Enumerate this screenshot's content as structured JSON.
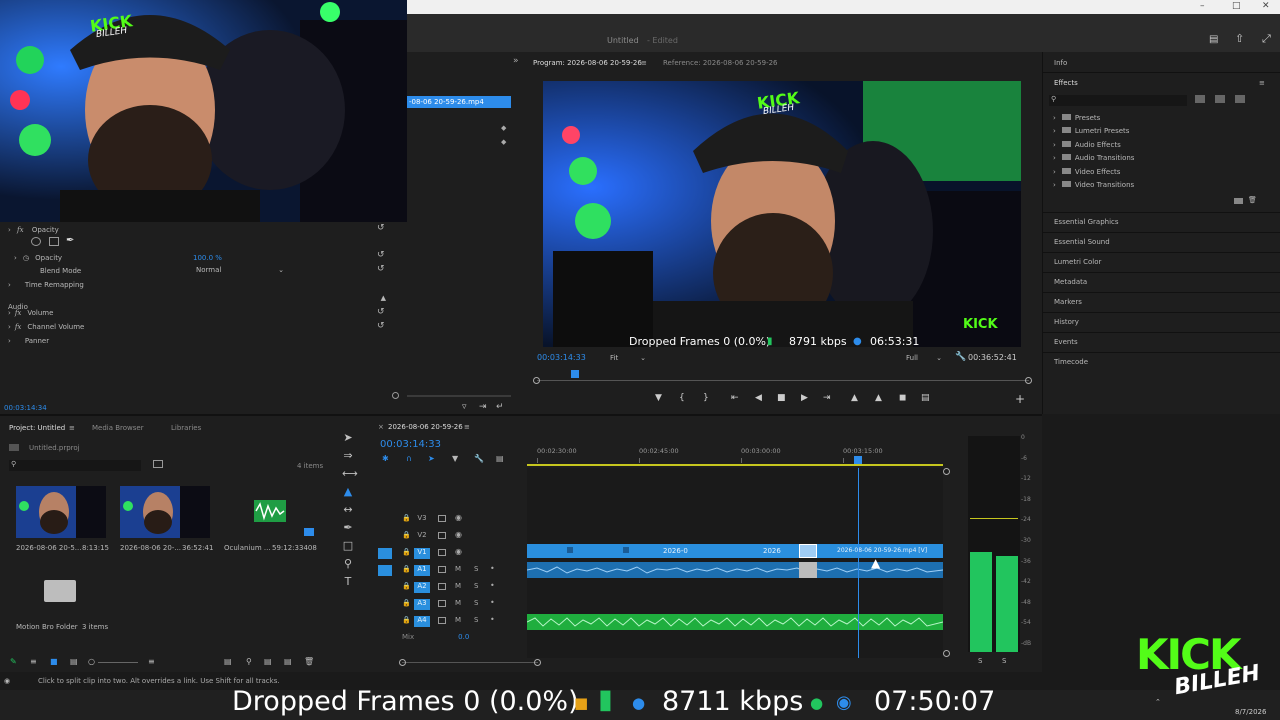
{
  "window": {
    "title": "Untitled",
    "edited": "- Edited"
  },
  "effect_controls": {
    "opacity_section": "Opacity",
    "opacity_label": "Opacity",
    "opacity_value": "100.0 %",
    "blend_label": "Blend Mode",
    "blend_value": "Normal",
    "time_remap": "Time Remapping",
    "audio_header": "Audio",
    "volume": "Volume",
    "channel_volume": "Channel Volume",
    "panner": "Panner",
    "timecode": "00:03:14:34"
  },
  "source_strip": {
    "clip_name": "-08-06 20-59-26.mp4",
    "header_partial": "-08-06 20-59-26"
  },
  "program": {
    "tab_program": "Program: 2026-08-06 20-59-26",
    "tab_reference": "Reference: 2026-08-06 20-59-26",
    "timecode_left": "00:03:14:33",
    "fit": "Fit",
    "full": "Full",
    "duration": "00:36:52:41"
  },
  "stats_overlay": {
    "dropped": "Dropped Frames 0 (0.0%)",
    "bitrate": "8791 kbps",
    "time": "06:53:31"
  },
  "bottom_stats": {
    "dropped": "Dropped Frames 0 (0.0%)",
    "bitrate": "8711 kbps",
    "time": "07:50:07"
  },
  "right_panel": {
    "info": "Info",
    "effects": "Effects",
    "tree": [
      "Presets",
      "Lumetri Presets",
      "Audio Effects",
      "Audio Transitions",
      "Video Effects",
      "Video Transitions"
    ],
    "sections": [
      "Essential Graphics",
      "Essential Sound",
      "Lumetri Color",
      "Metadata",
      "Markers",
      "History",
      "Events",
      "Timecode"
    ]
  },
  "project": {
    "tab_project": "Project: Untitled",
    "tab_media": "Media Browser",
    "tab_libraries": "Libraries",
    "file": "Untitled.prproj",
    "count": "4 items",
    "items": [
      {
        "name": "2026-08-06 20-5...",
        "dur": "8:13:15"
      },
      {
        "name": "2026-08-06 20-...",
        "dur": "36:52:41"
      },
      {
        "name": "Oculanium ...",
        "dur": "59:12:33408"
      }
    ],
    "folder_name": "Motion Bro Folder",
    "folder_count": "3 items"
  },
  "timeline": {
    "sequence": "2026-08-06 20-59-26",
    "timecode": "00:03:14:33",
    "ruler": [
      "00:02:30:00",
      "00:02:45:00",
      "00:03:00:00",
      "00:03:15:00"
    ],
    "video_tracks": [
      "V3",
      "V2",
      "V1"
    ],
    "audio_tracks": [
      "A1",
      "A2",
      "A3",
      "A4"
    ],
    "mix_label": "Mix",
    "mix_value": "0.0",
    "clip_labels": [
      "2026-0",
      "2026",
      "2026-08-06 20-59-26.mp4 [V]"
    ],
    "track_m": "M",
    "track_s": "S"
  },
  "meter": {
    "scale": [
      "0",
      "-6",
      "-12",
      "-18",
      "-24",
      "-30",
      "-36",
      "-42",
      "-48",
      "-54",
      "-dB"
    ],
    "ss": [
      "S",
      "S"
    ]
  },
  "status": {
    "hint": "Click to split clip into two. Alt overrides a link. Use Shift for all tracks."
  },
  "taskbar": {
    "date": "8/7/2026",
    "logo_text": "KICK",
    "logo_sub": "BILLEH"
  },
  "webcam_cap_text": "KICK",
  "webcam_cap_sub": "BILLEH",
  "colors": {
    "accent_blue": "#2d8ceb",
    "clip_blue": "#2a8fde",
    "audio_green": "#22c55e",
    "kick_green": "#53fc18"
  }
}
